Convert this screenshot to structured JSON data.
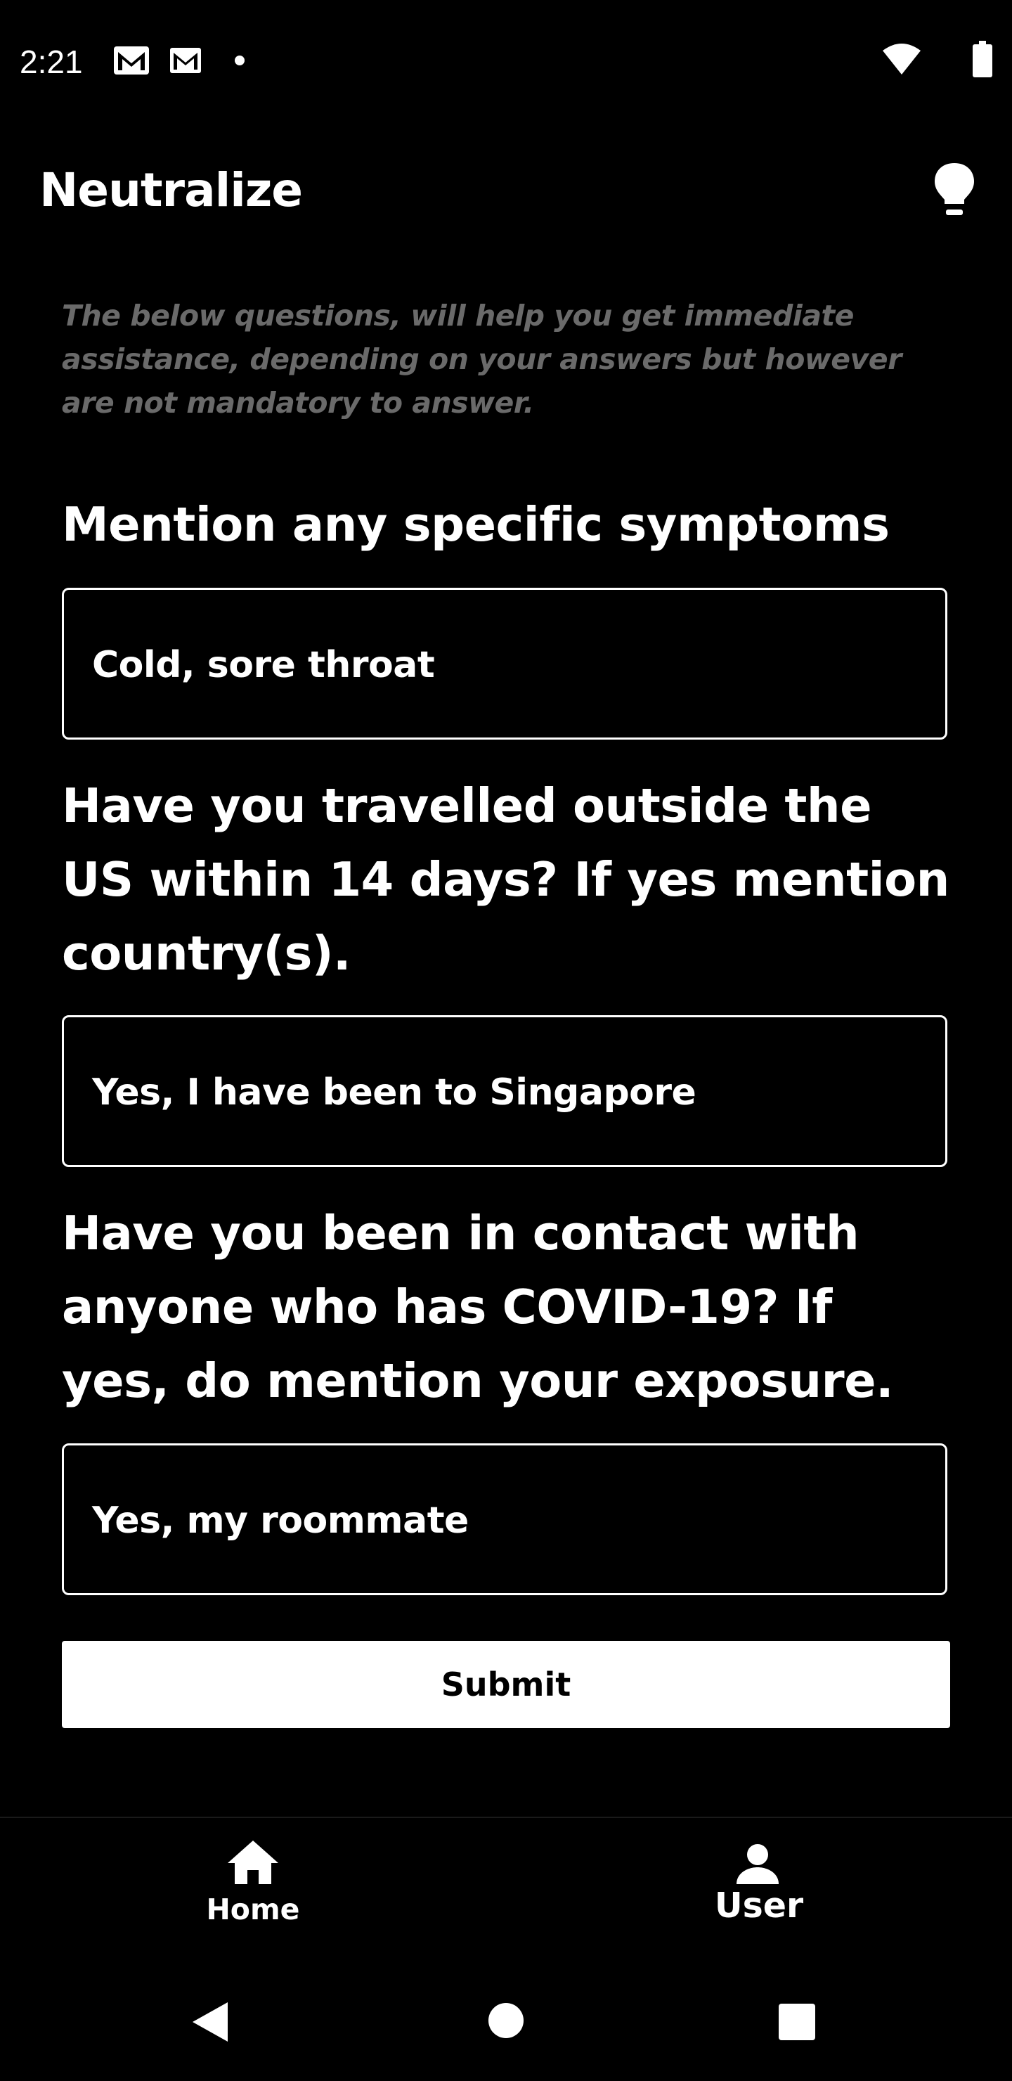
{
  "status_bar": {
    "time": "2:21",
    "icons": [
      "gmail-icon",
      "gmail-icon",
      "notification-dot-icon",
      "wifi-icon",
      "battery-icon"
    ]
  },
  "app_bar": {
    "title": "Neutralize",
    "action_icon": "lightbulb-icon"
  },
  "form": {
    "note": "The below questions, will help you get immediate assistance, depending on your answers but however are not mandatory to answer.",
    "questions": [
      {
        "label": "Mention any specific symptoms",
        "value": "Cold, sore throat"
      },
      {
        "label": "Have you travelled outside the US within 14 days? If yes mention country(s).",
        "value": "Yes, I have been to Singapore"
      },
      {
        "label": "Have you been in contact with anyone who has COVID-19? If yes, do mention your exposure.",
        "value": "Yes, my roommate"
      }
    ],
    "submit_label": "Submit"
  },
  "bottom_nav": {
    "items": [
      {
        "label": "Home",
        "icon": "home-icon"
      },
      {
        "label": "User",
        "icon": "person-icon"
      }
    ]
  },
  "system_nav": {
    "icons": [
      "back-icon",
      "home-circle-icon",
      "recents-icon"
    ]
  },
  "colors": {
    "background": "#000000",
    "text": "#ffffff",
    "note_text": "#6a6a6a",
    "button_bg": "#ffffff",
    "button_text": "#000000"
  }
}
